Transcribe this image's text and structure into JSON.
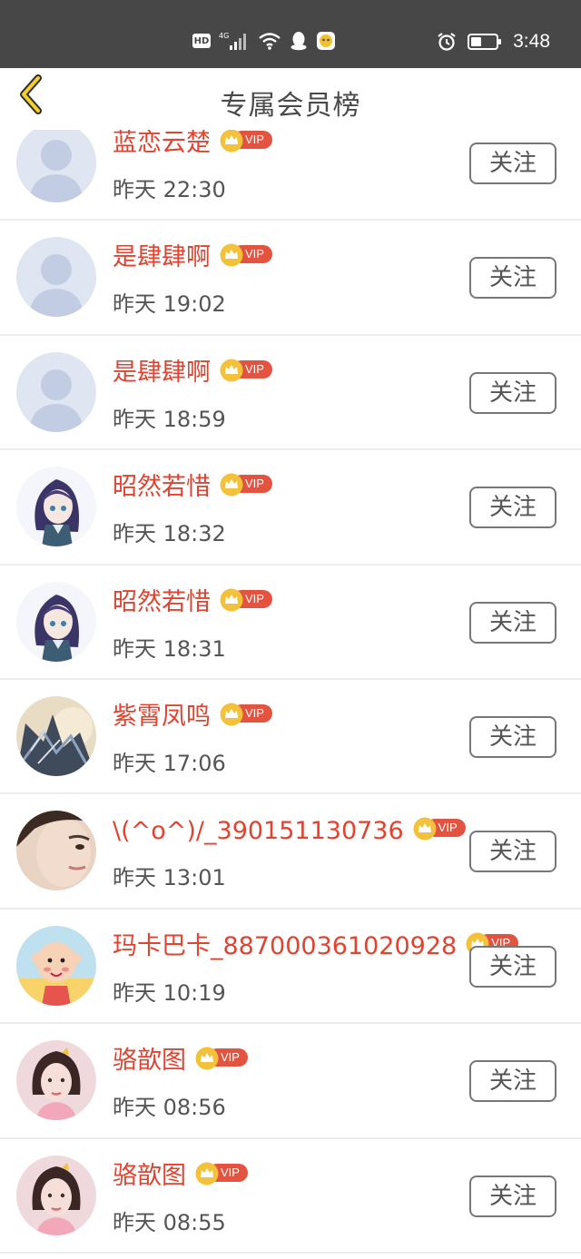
{
  "status_bar": {
    "hd_label": "HD",
    "network_label": "4G",
    "time": "3:48",
    "icons": [
      "hd-icon",
      "signal-icon",
      "wifi-icon",
      "qq-icon",
      "app-notification-icon",
      "alarm-icon",
      "battery-icon"
    ]
  },
  "header": {
    "title": "专属会员榜",
    "back_icon": "chevron-left-icon"
  },
  "vip_label": "VIP",
  "follow_label": "关注",
  "members": [
    {
      "name": "蓝恋云楚",
      "time": "昨天 22:30",
      "avatar": "default-avatar"
    },
    {
      "name": "是肆肆啊",
      "time": "昨天 19:02",
      "avatar": "default-avatar"
    },
    {
      "name": "是肆肆啊",
      "time": "昨天 18:59",
      "avatar": "default-avatar"
    },
    {
      "name": "昭然若惜",
      "time": "昨天 18:32",
      "avatar": "anime-girl-avatar"
    },
    {
      "name": "昭然若惜",
      "time": "昨天 18:31",
      "avatar": "anime-girl-avatar"
    },
    {
      "name": "紫霄凤鸣",
      "time": "昨天 17:06",
      "avatar": "ink-art-avatar"
    },
    {
      "name": "\\(^o^)/_390151130736",
      "time": "昨天 13:01",
      "avatar": "face-photo-avatar"
    },
    {
      "name": "玛卡巴卡_887000361020928",
      "time": "昨天 10:19",
      "avatar": "cartoon-kid-avatar"
    },
    {
      "name": "骆歆图",
      "time": "昨天 08:56",
      "avatar": "girl-photo-avatar"
    },
    {
      "name": "骆歆图",
      "time": "昨天 08:55",
      "avatar": "girl-photo-avatar"
    }
  ]
}
